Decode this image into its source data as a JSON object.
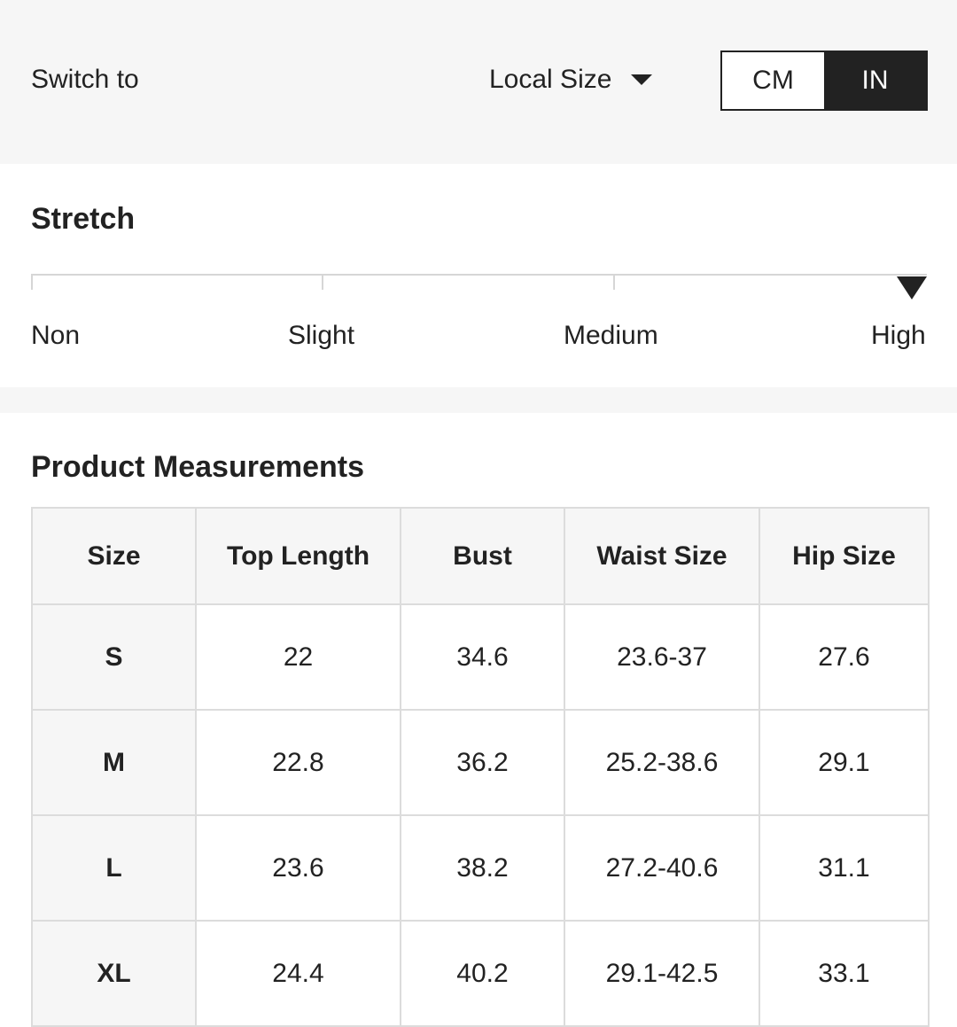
{
  "header": {
    "switch_label": "Switch to",
    "size_select": {
      "selected": "Local Size",
      "icon": "caret-down-icon"
    },
    "unit_toggle": {
      "options": [
        "CM",
        "IN"
      ],
      "selected": "IN"
    }
  },
  "stretch": {
    "title": "Stretch",
    "levels": [
      "Non",
      "Slight",
      "Medium",
      "High"
    ],
    "selected_level": "High",
    "marker_icon": "triangle-down-icon"
  },
  "measurements": {
    "title": "Product Measurements",
    "columns": [
      "Size",
      "Top Length",
      "Bust",
      "Waist Size",
      "Hip Size"
    ],
    "rows": [
      [
        "S",
        "22",
        "34.6",
        "23.6-37",
        "27.6"
      ],
      [
        "M",
        "22.8",
        "36.2",
        "25.2-38.6",
        "29.1"
      ],
      [
        "L",
        "23.6",
        "38.2",
        "27.2-40.6",
        "31.1"
      ],
      [
        "XL",
        "24.4",
        "40.2",
        "29.1-42.5",
        "33.1"
      ]
    ]
  },
  "colors": {
    "panel_background": "#f6f6f6",
    "text": "#222222",
    "active_toggle": "#222222",
    "border": "#dcdcdc"
  }
}
